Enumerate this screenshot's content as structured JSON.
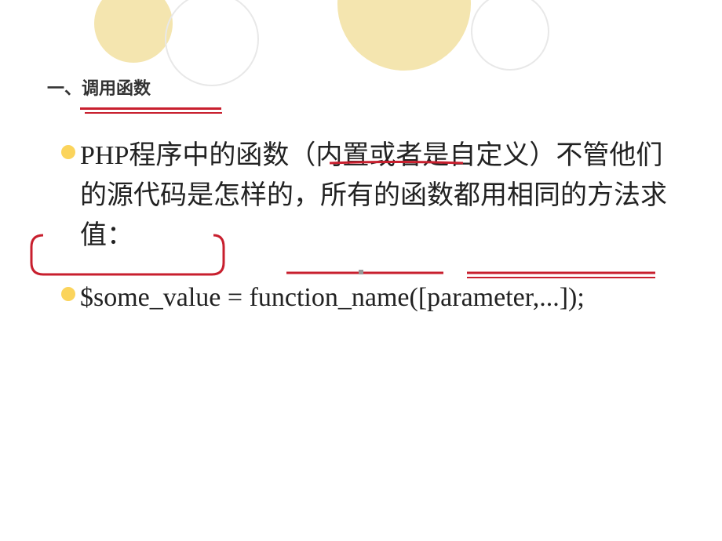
{
  "title": "一、调用函数",
  "bullets": [
    "PHP程序中的函数（内置或者是自定义）不管他们的源代码是怎样的，所有的函数都用相同的方法求值：",
    "$some_value = function_name([parameter,...]);"
  ],
  "annotations": {
    "color": "#c81f2e"
  }
}
